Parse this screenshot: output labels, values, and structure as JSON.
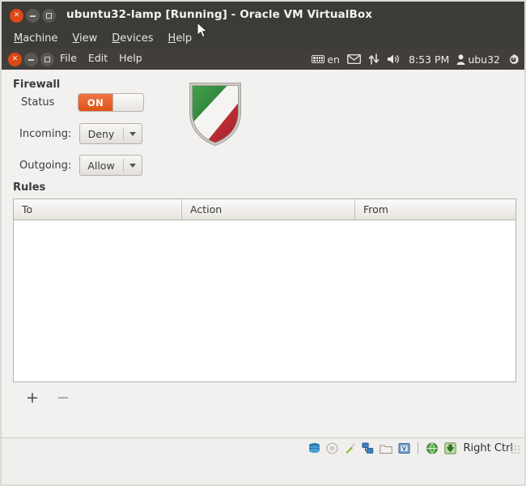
{
  "vbox": {
    "title": "ubuntu32-lamp [Running] - Oracle VM VirtualBox",
    "window_buttons": [
      {
        "name": "close",
        "glyph": "x"
      },
      {
        "name": "minimize",
        "glyph": "-"
      },
      {
        "name": "maximize",
        "glyph": "[]"
      }
    ],
    "menus": [
      {
        "label": "Machine",
        "mnemonic": "M"
      },
      {
        "label": "View",
        "mnemonic": "V"
      },
      {
        "label": "Devices",
        "mnemonic": "D"
      },
      {
        "label": "Help",
        "mnemonic": "H"
      }
    ],
    "statusbar": {
      "icons": [
        "hard-disk-icon",
        "optical-disk-icon",
        "usb-icon",
        "network-icon",
        "shared-folder-icon",
        "display-icon",
        "remote-display-icon",
        "host-key-icon"
      ],
      "host_key": "Right Ctrl"
    }
  },
  "guest": {
    "panel": {
      "menus": [
        "File",
        "Edit",
        "Help"
      ],
      "indicators": {
        "keyboard_layout": "en",
        "keyboard_icon": "keyboard-icon",
        "messaging_icon": "envelope-icon",
        "network_icon": "network-updown-icon",
        "volume_icon": "volume-icon",
        "time": "8:53 PM",
        "user_icon": "user-icon",
        "user": "ubu32",
        "session_icon": "power-gear-icon"
      }
    }
  },
  "gufw": {
    "firewall": {
      "section_title": "Firewall",
      "status_label": "Status",
      "status_value": "ON",
      "status_on": true,
      "incoming_label": "Incoming:",
      "incoming_value": "Deny",
      "outgoing_label": "Outgoing:",
      "outgoing_value": "Allow",
      "shield_icon": "shield-icon",
      "shield_colors": {
        "green": "#2e8b39",
        "white": "#f4f2f0",
        "red": "#b41f27",
        "border": "#9a9691"
      }
    },
    "rules": {
      "section_title": "Rules",
      "columns": [
        "To",
        "Action",
        "From"
      ],
      "rows": [],
      "add_button": "+",
      "remove_button": "−"
    }
  },
  "colors": {
    "titlebar_bg": "#3d3b37",
    "panel_bg": "#423f3b",
    "app_bg": "#f2f1f0",
    "accent_orange": "#dd4814",
    "table_bg": "#ffffff"
  }
}
